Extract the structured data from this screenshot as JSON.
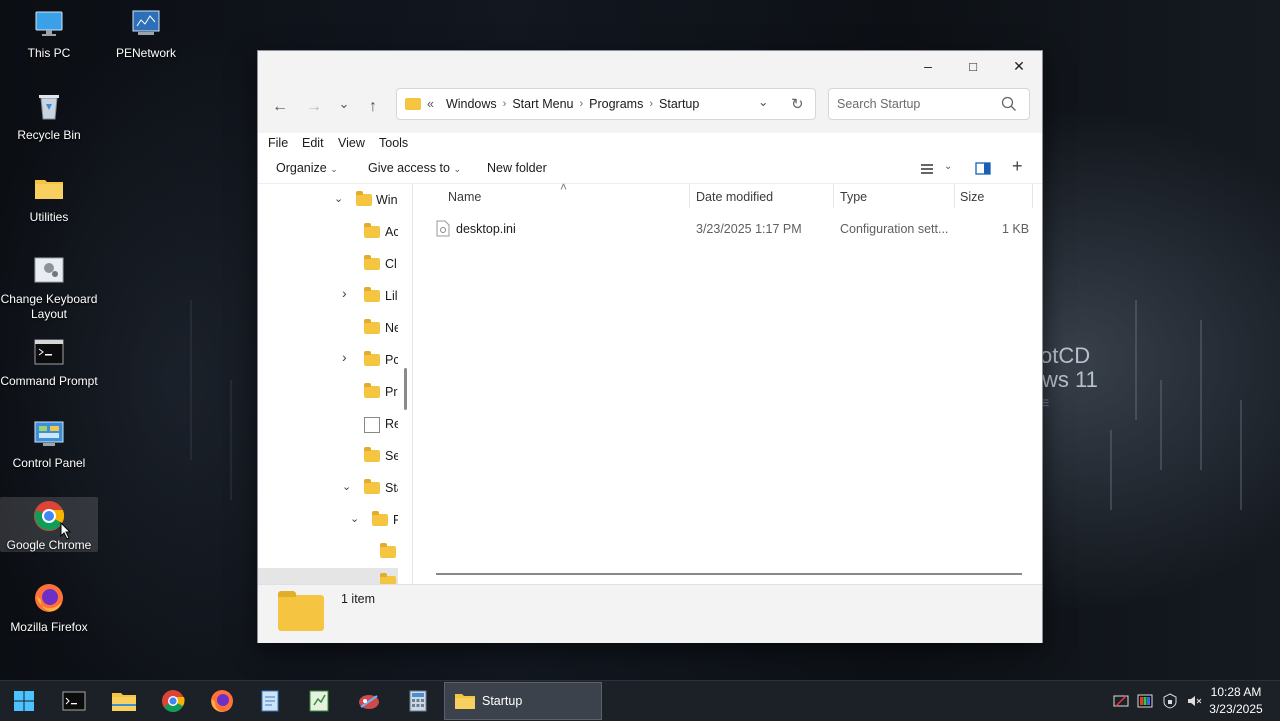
{
  "desktop": {
    "icons": [
      {
        "label": "This PC",
        "icon": "monitor-icon"
      },
      {
        "label": "PENetwork",
        "icon": "network-icon"
      },
      {
        "label": "Recycle Bin",
        "icon": "recycle-bin-icon"
      },
      {
        "label": "Utilities",
        "icon": "folder-icon"
      },
      {
        "label": "Change Keyboard Layout",
        "icon": "keyboard-icon"
      },
      {
        "label": "Command Prompt",
        "icon": "terminal-icon"
      },
      {
        "label": "Control Panel",
        "icon": "control-panel-icon"
      },
      {
        "label": "Google Chrome",
        "icon": "chrome-icon"
      },
      {
        "label": "Mozilla Firefox",
        "icon": "firefox-icon"
      }
    ],
    "watermark": {
      "line1": "otCD",
      "line2": "ws 11",
      "line3": "≡"
    }
  },
  "explorer": {
    "caption": {
      "minimize": "–",
      "maximize": "□",
      "close": "✕"
    },
    "nav": {
      "back": "←",
      "forward": "→",
      "recent": "⌄",
      "up": "↑"
    },
    "address": {
      "overflow": "«",
      "segments": [
        "Windows",
        "Start Menu",
        "Programs",
        "Startup"
      ],
      "dropdown": "⌄",
      "refresh": "↻"
    },
    "search": {
      "placeholder": "Search Startup"
    },
    "menu": [
      "File",
      "Edit",
      "View",
      "Tools"
    ],
    "commands": {
      "organize": "Organize",
      "give_access": "Give access to",
      "new_folder": "New folder"
    },
    "nav_pane": [
      {
        "label": "Win",
        "chevron": "⌄",
        "indent": 1
      },
      {
        "label": "Ac",
        "chevron": "",
        "indent": 2
      },
      {
        "label": "Cl",
        "chevron": "",
        "indent": 2
      },
      {
        "label": "Lil",
        "chevron": "›",
        "indent": 2
      },
      {
        "label": "Ne",
        "chevron": "",
        "indent": 2
      },
      {
        "label": "Pc",
        "chevron": "›",
        "indent": 2
      },
      {
        "label": "Pr",
        "chevron": "",
        "indent": 2
      },
      {
        "label": "Re",
        "chevron": "",
        "indent": 2
      },
      {
        "label": "Se",
        "chevron": "",
        "indent": 2
      },
      {
        "label": "Sta",
        "chevron": "⌄",
        "indent": 2
      },
      {
        "label": "P",
        "chevron": "⌄",
        "indent": 3
      },
      {
        "label": "",
        "chevron": "",
        "indent": 4
      }
    ],
    "columns": [
      "Name",
      "Date modified",
      "Type",
      "Size"
    ],
    "sort_indicator": "˄",
    "files": [
      {
        "name": "desktop.ini",
        "date": "3/23/2025 1:17 PM",
        "type": "Configuration sett...",
        "size": "1 KB"
      }
    ],
    "status": {
      "count": "1 item"
    }
  },
  "taskbar": {
    "active_window": "Startup",
    "clock": {
      "time": "10:28 AM",
      "date": "3/23/2025"
    }
  }
}
